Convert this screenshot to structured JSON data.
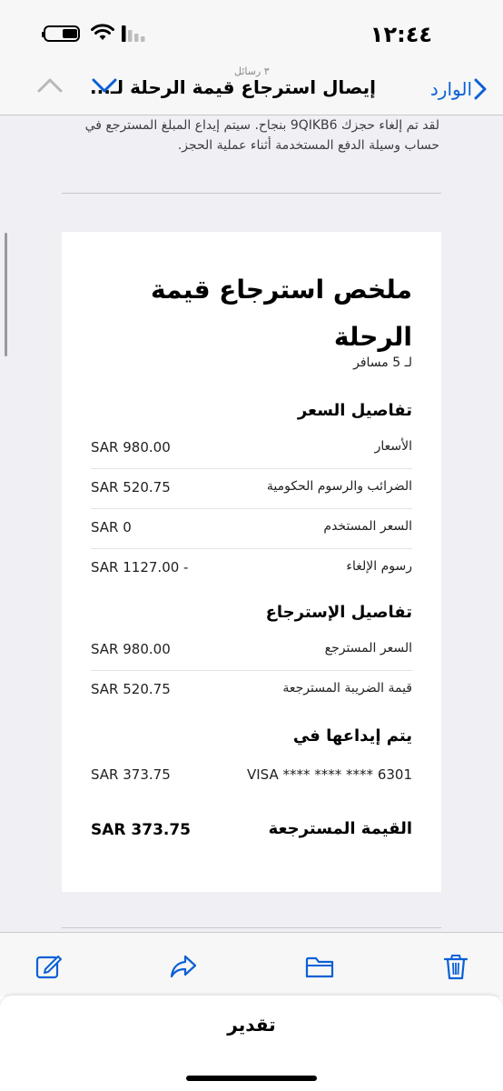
{
  "status": {
    "time": "١٢:٤٤",
    "battery_percent": 50
  },
  "nav": {
    "back_label": "الوارد",
    "title": "إيصال استرجاع قيمة الرحلة لـ...",
    "message_count": "٣ رسائل"
  },
  "email": {
    "intro_text": "لقد تم إلغاء حجزك 9QIKB6 بنجاح. سيتم إيداع المبلغ المسترجع في حساب وسيلة الدفع المستخدمة أثناء عملية الحجز.",
    "title": "ملخص استرجاع قيمة الرحلة",
    "passengers": "لـ 5 مسافر",
    "price_section": {
      "title": "تفاصيل السعر",
      "rows": [
        {
          "label": "الأسعار",
          "value": "SAR 980.00"
        },
        {
          "label": "الضرائب والرسوم الحكومية",
          "value": "SAR 520.75"
        },
        {
          "label": "السعر المستخدم",
          "value": "SAR 0"
        },
        {
          "label": "رسوم الإلغاء",
          "value": "SAR 1127.00 -"
        }
      ]
    },
    "refund_section": {
      "title": "تفاصيل الإسترجاع",
      "rows": [
        {
          "label": "السعر المسترجع",
          "value": "SAR 980.00"
        },
        {
          "label": "قيمة الضريبة المسترجعة",
          "value": "SAR 520.75"
        }
      ]
    },
    "deposit_section": {
      "title": "يتم إيداعها في",
      "card": "VISA **** **** **** 6301",
      "amount": "SAR 373.75"
    },
    "total": {
      "label": "القيمة المسترجعة",
      "value": "SAR 373.75"
    }
  },
  "toolbar": {
    "icons": [
      "compose-icon",
      "forward-icon",
      "folder-icon",
      "trash-icon"
    ],
    "accent_color": "#0a60d6"
  },
  "bottom_bar": {
    "label": "تقدير"
  }
}
